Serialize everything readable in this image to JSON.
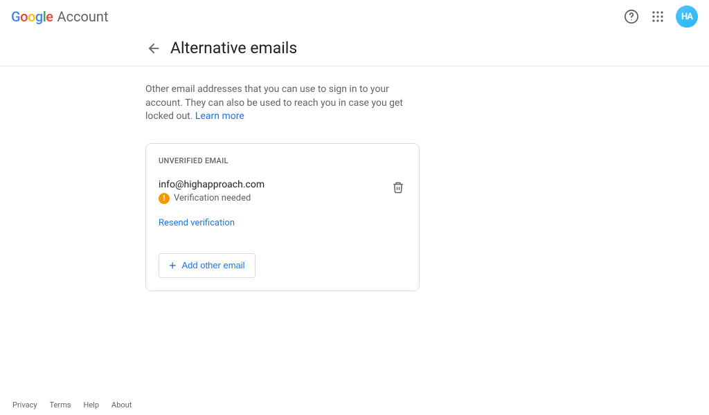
{
  "header": {
    "product": "Account",
    "avatar_initials": "HA"
  },
  "page": {
    "title": "Alternative emails",
    "description_part1": "Other email addresses that you can use to sign in to your account. They can also be used to reach you in case you get locked out. ",
    "learn_more": "Learn more"
  },
  "card": {
    "label": "UNVERIFIED EMAIL",
    "email": "info@highapproach.com",
    "status": "Verification needed",
    "resend": "Resend verification",
    "add_label": "Add other email"
  },
  "footer": {
    "privacy": "Privacy",
    "terms": "Terms",
    "help": "Help",
    "about": "About"
  }
}
